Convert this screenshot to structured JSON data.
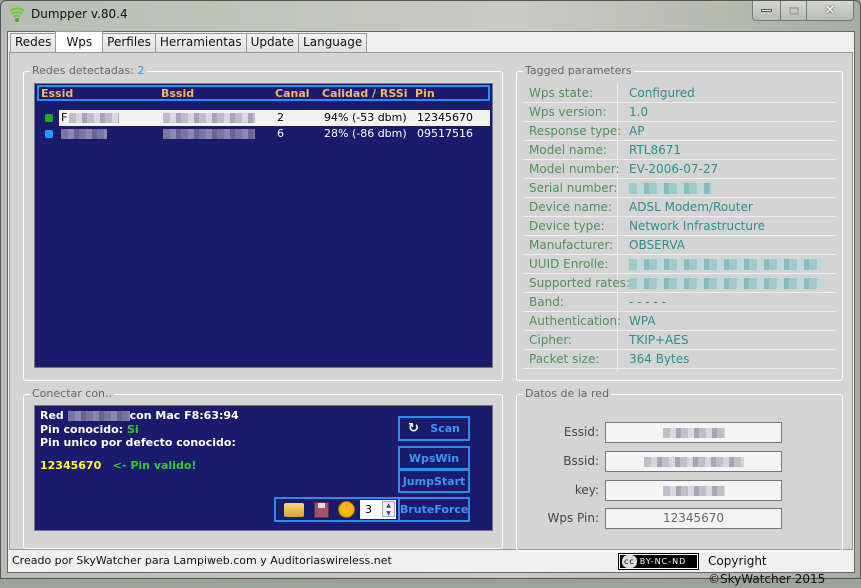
{
  "window": {
    "title": "Dumpper v.80.4"
  },
  "tabs": [
    "Redes",
    "Wps",
    "Perfiles",
    "Herramientas",
    "Update",
    "Language"
  ],
  "active_tab": "Wps",
  "networks": {
    "label": "Redes detectadas:",
    "count": "2",
    "columns": [
      "Essid",
      "Bssid",
      "Canal",
      "Calidad / RSSi",
      "Pin"
    ],
    "rows": [
      {
        "essid_prefix": "F",
        "canal": "2",
        "calidad": "94% (-53 dbm)",
        "pin": "12345670",
        "selected": true
      },
      {
        "essid_prefix": "",
        "canal": "6",
        "calidad": "28% (-86 dbm)",
        "pin": "09517516",
        "selected": false
      }
    ]
  },
  "tagged": {
    "label": "Tagged parameters",
    "rows": [
      {
        "k": "Wps state:",
        "v": "Configured"
      },
      {
        "k": "Wps version:",
        "v": "1.0"
      },
      {
        "k": "Response type:",
        "v": "AP"
      },
      {
        "k": "Model name:",
        "v": "RTL8671"
      },
      {
        "k": "Model number:",
        "v": "EV-2006-07-27"
      },
      {
        "k": "Serial number:",
        "v": null
      },
      {
        "k": "Device name:",
        "v": "ADSL Modem/Router"
      },
      {
        "k": "Device type:",
        "v": "Network Infrastructure"
      },
      {
        "k": "Manufacturer:",
        "v": "OBSERVA"
      },
      {
        "k": "UUID Enrolle:",
        "v": null
      },
      {
        "k": "Supported rates:",
        "v": null
      },
      {
        "k": "Band:",
        "v": "- - - - -"
      },
      {
        "k": "Authentication:",
        "v": "WPA"
      },
      {
        "k": "Cipher:",
        "v": "TKIP+AES"
      },
      {
        "k": "Packet size:",
        "v": "364 Bytes"
      }
    ]
  },
  "connect": {
    "label": "Conectar con..",
    "red": "Red",
    "mac_text": "con Mac F8:63:94",
    "pin_known_label": "Pin conocido:",
    "pin_known_value": "Si",
    "default_pin_label": "Pin unico por defecto conocido:",
    "pin": "12345670",
    "pin_status": "<- Pin valido!",
    "buttons": {
      "scan": "Scan",
      "wpswin": "WpsWin",
      "jumpstart": "JumpStart",
      "bruteforce": "BruteForce"
    },
    "spinner_value": "3"
  },
  "datos": {
    "label": "Datos de la red",
    "essid_label": "Essid:",
    "bssid_label": "Bssid:",
    "key_label": "key:",
    "pin_label": "Wps Pin:",
    "pin_value": "12345670"
  },
  "status": {
    "credit": "Creado por SkyWatcher para Lampiweb.com y Auditoriaswireless.net",
    "license": "BY-NC-ND",
    "cc": "cc",
    "copyright": "Copyright ©SkyWatcher 2015"
  }
}
